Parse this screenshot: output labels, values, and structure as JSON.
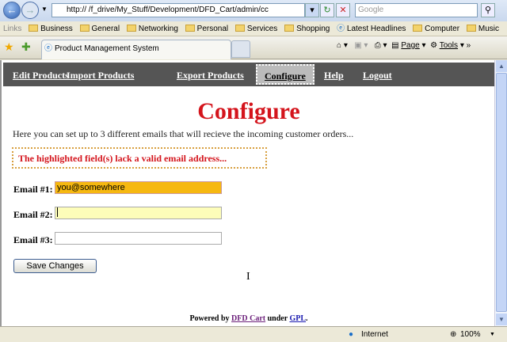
{
  "browser": {
    "address": "http://                          /f_drive/My_Stuff/Development/DFD_Cart/admin/cc",
    "search_placeholder": "Google",
    "links_label": "Links",
    "links": [
      "Business",
      "General",
      "Networking",
      "Personal",
      "Services",
      "Shopping",
      "Latest Headlines",
      "Computer",
      "Music"
    ],
    "tab_title": "Product Management System",
    "page_menu": "Page",
    "tools_menu": "Tools",
    "zone": "Internet",
    "zoom": "100%"
  },
  "menu": {
    "items": [
      "Edit Products",
      "Import Products",
      "Export Products",
      "Configure",
      "Help",
      "Logout"
    ],
    "active": "Configure"
  },
  "page": {
    "title": "Configure",
    "intro": "Here you can set up to 3 different emails that will recieve the incoming customer orders...",
    "error": "The highlighted field(s) lack a valid email address...",
    "fields": [
      {
        "label": "Email #1:",
        "value": "you@somewhere"
      },
      {
        "label": "Email #2:",
        "value": ""
      },
      {
        "label": "Email #3:",
        "value": ""
      }
    ],
    "save_label": "Save Changes",
    "footer": {
      "prefix": "Powered by",
      "link1": "DFD Cart",
      "middle": "under",
      "link2": "GPL",
      "suffix": "."
    }
  },
  "colors": {
    "title": "#d4141c",
    "invalid_field": "#f6b810",
    "focused_field": "#fdfdb9",
    "menu_bg": "#555555"
  }
}
